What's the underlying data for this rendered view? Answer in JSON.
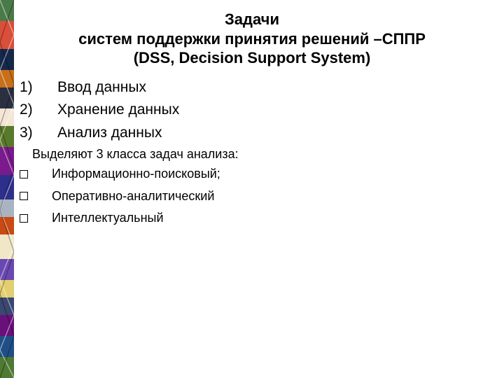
{
  "title": {
    "line1": "Задачи",
    "line2": "систем поддержки принятия решений –СППР",
    "line3": "(DSS, Decision Support System)"
  },
  "numbered_items": [
    {
      "num": "1)",
      "text": "Ввод данных"
    },
    {
      "num": "2)",
      "text": "Хранение данных"
    },
    {
      "num": "3)",
      "text": "Анализ данных"
    }
  ],
  "sub_heading": "Выделяют 3 класса задач анализа:",
  "box_items": [
    "Информационно-поисковый;",
    "Оперативно-аналитический",
    "Интеллектуальный"
  ]
}
